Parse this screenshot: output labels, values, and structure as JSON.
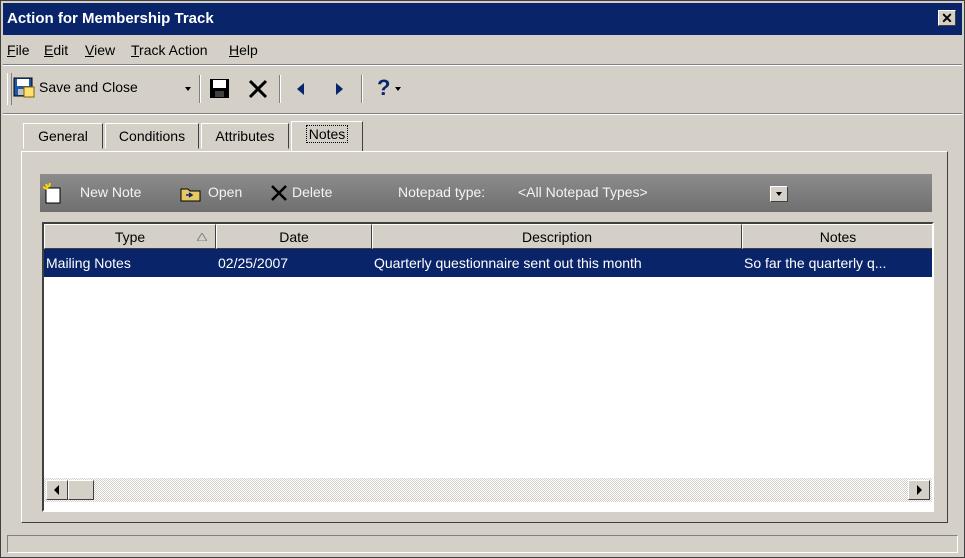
{
  "window": {
    "title": "Action for Membership Track",
    "close_glyph": "✕"
  },
  "menu": [
    {
      "label": "File",
      "u": "F",
      "rest": "ile"
    },
    {
      "label": "Edit",
      "u": "E",
      "rest": "dit"
    },
    {
      "label": "View",
      "u": "V",
      "rest": "iew"
    },
    {
      "label": "Track Action",
      "u": "T",
      "rest": "rack Action"
    },
    {
      "label": "Help",
      "u": "H",
      "rest": "elp"
    }
  ],
  "toolbar": {
    "save_close_label": "Save and Close",
    "help_glyph": "?"
  },
  "tabs": [
    {
      "label": "General"
    },
    {
      "label": "Conditions"
    },
    {
      "label": "Attributes"
    },
    {
      "label": "Notes"
    }
  ],
  "notes": {
    "new_note_label": "New Note",
    "open_label": "Open",
    "delete_label": "Delete",
    "notepad_type_label": "Notepad type:",
    "notepad_type_value": "<All Notepad Types>"
  },
  "grid": {
    "columns": [
      "Type",
      "Date",
      "Description",
      "Notes"
    ],
    "sorted_column": "Type",
    "rows": [
      {
        "type": "Mailing Notes",
        "date": "02/25/2007",
        "description": "Quarterly questionnaire sent out this month",
        "notes": "So far the quarterly q..."
      }
    ]
  },
  "colors": {
    "selection": "#0a246a",
    "titlebar": "#0a246a",
    "chrome": "#d4d0c8"
  }
}
